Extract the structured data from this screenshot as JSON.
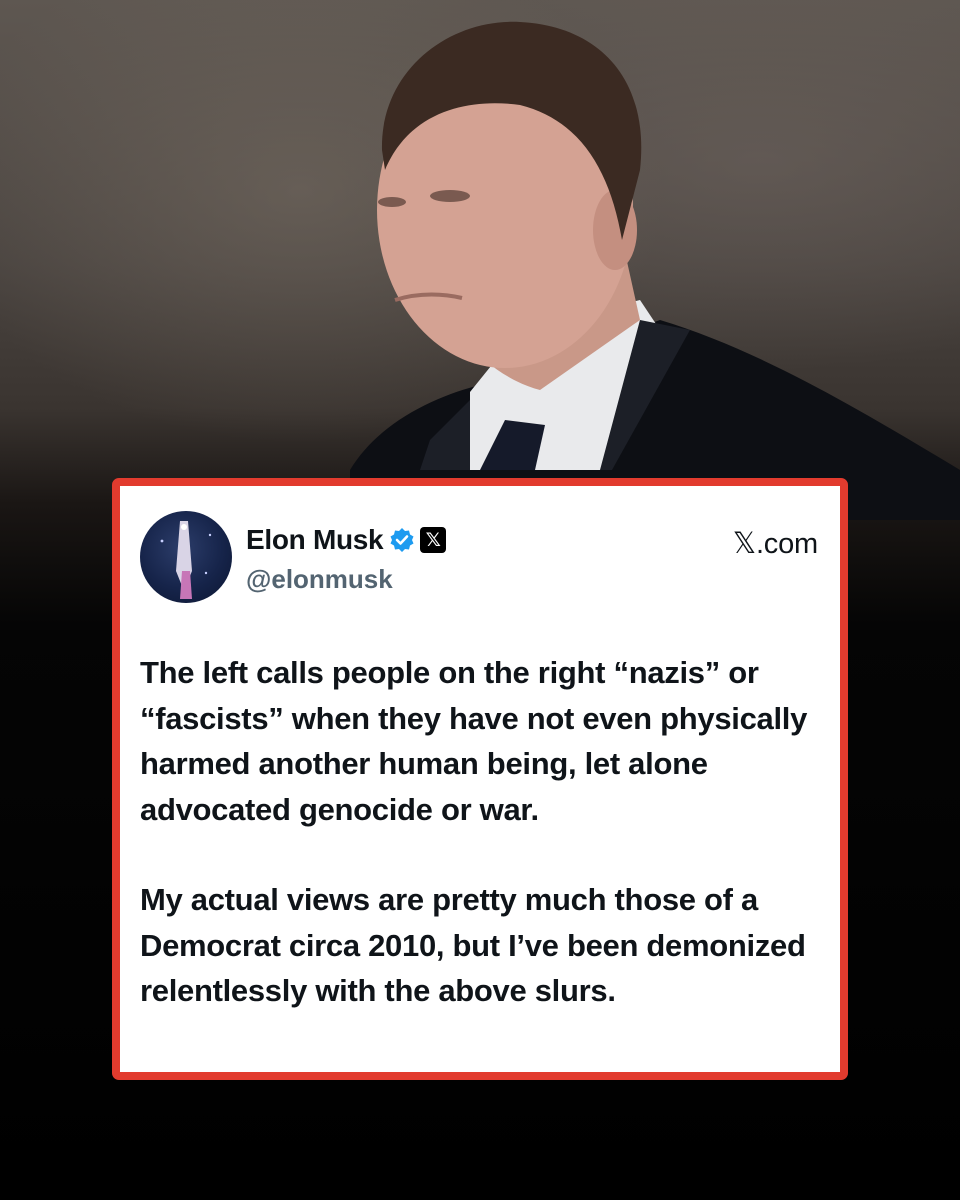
{
  "post": {
    "display_name": "Elon Musk",
    "handle": "@elonmusk",
    "site": "𝕏.com",
    "x_badge": "𝕏",
    "verified_icon": "verified-badge-icon",
    "paragraphs": [
      "The left calls people on the right “nazis” or “fascists” when they have not even physically harmed another human being, let alone advocated genocide or war.",
      "My actual views are pretty much those of a Democrat circa 2010, but I’ve been demonized relentlessly with the above slurs."
    ]
  },
  "colors": {
    "frame": "#e23b2e",
    "verified": "#1d9bf0",
    "text": "#0f1419",
    "handle": "#536471"
  }
}
